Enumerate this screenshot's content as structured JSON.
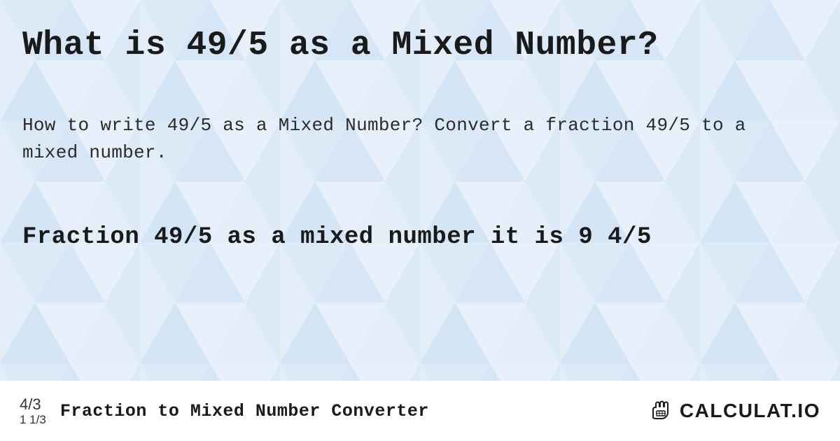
{
  "main": {
    "heading": "What is 49/5 as a Mixed Number?",
    "description": "How to write 49/5 as a Mixed Number? Convert a fraction 49/5 to a mixed number.",
    "answer": "Fraction 49/5 as a mixed number it is 9 4/5"
  },
  "footer": {
    "example_top": "4/3",
    "example_bottom": "1 1/3",
    "title": "Fraction to Mixed Number Converter",
    "brand": "CALCULAT.IO"
  },
  "colors": {
    "bg_light": "#e8f1fb",
    "bg_mid": "#d4e5f6",
    "bg_dark": "#bfd8f0",
    "text": "#1a1a1a"
  }
}
